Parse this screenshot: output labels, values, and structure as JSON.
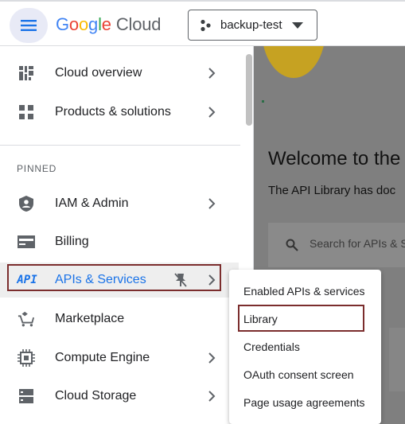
{
  "header": {
    "logo_google_letters": [
      "G",
      "o",
      "o",
      "g",
      "l",
      "e"
    ],
    "logo_cloud": "Cloud",
    "project_name": "backup-test"
  },
  "sidebar": {
    "top_items": [
      {
        "label": "Cloud overview",
        "icon": "dashboard-icon",
        "has_chevron": true
      },
      {
        "label": "Products & solutions",
        "icon": "grid-icon",
        "has_chevron": true
      }
    ],
    "section_label": "PINNED",
    "pinned_items": [
      {
        "label": "IAM & Admin",
        "icon": "shield-icon",
        "has_chevron": true
      },
      {
        "label": "Billing",
        "icon": "billing-icon",
        "has_chevron": false
      },
      {
        "label": "APIs & Services",
        "icon": "api-icon",
        "icon_text": "API",
        "has_chevron": true,
        "pinned": true,
        "active": true
      },
      {
        "label": "Marketplace",
        "icon": "cart-icon",
        "has_chevron": false
      },
      {
        "label": "Compute Engine",
        "icon": "chip-icon",
        "has_chevron": true
      },
      {
        "label": "Cloud Storage",
        "icon": "storage-icon",
        "has_chevron": true
      }
    ]
  },
  "main": {
    "welcome_title": "Welcome to the",
    "subtext": "The API Library has doc",
    "search_placeholder": "Search for APIs & S"
  },
  "submenu": {
    "items": [
      {
        "label": "Enabled APIs & services"
      },
      {
        "label": "Library",
        "highlighted": true
      },
      {
        "label": "Credentials"
      },
      {
        "label": "OAuth consent screen"
      },
      {
        "label": "Page usage agreements"
      }
    ]
  },
  "colors": {
    "accent": "#1a73e8",
    "highlight_border": "#7b2d2d",
    "overlay": "#7f7f7f"
  }
}
